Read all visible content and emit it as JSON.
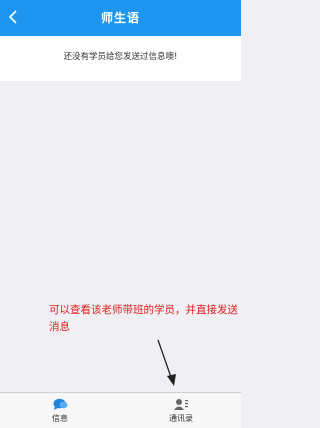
{
  "header": {
    "title": "师生语"
  },
  "main": {
    "empty_message": "还没有学员给您发送过信息噢!"
  },
  "annotation": {
    "text": "可以查看该老师带班的学员，并直接发送消息"
  },
  "tabbar": {
    "tabs": [
      {
        "label": "信息",
        "icon": "chat-bubble-icon"
      },
      {
        "label": "通讯录",
        "icon": "contacts-icon"
      }
    ]
  },
  "colors": {
    "header": "#1e96f0",
    "annotation": "#e02020",
    "tab_icon_active": "#1e86e0",
    "tab_icon": "#666666"
  }
}
